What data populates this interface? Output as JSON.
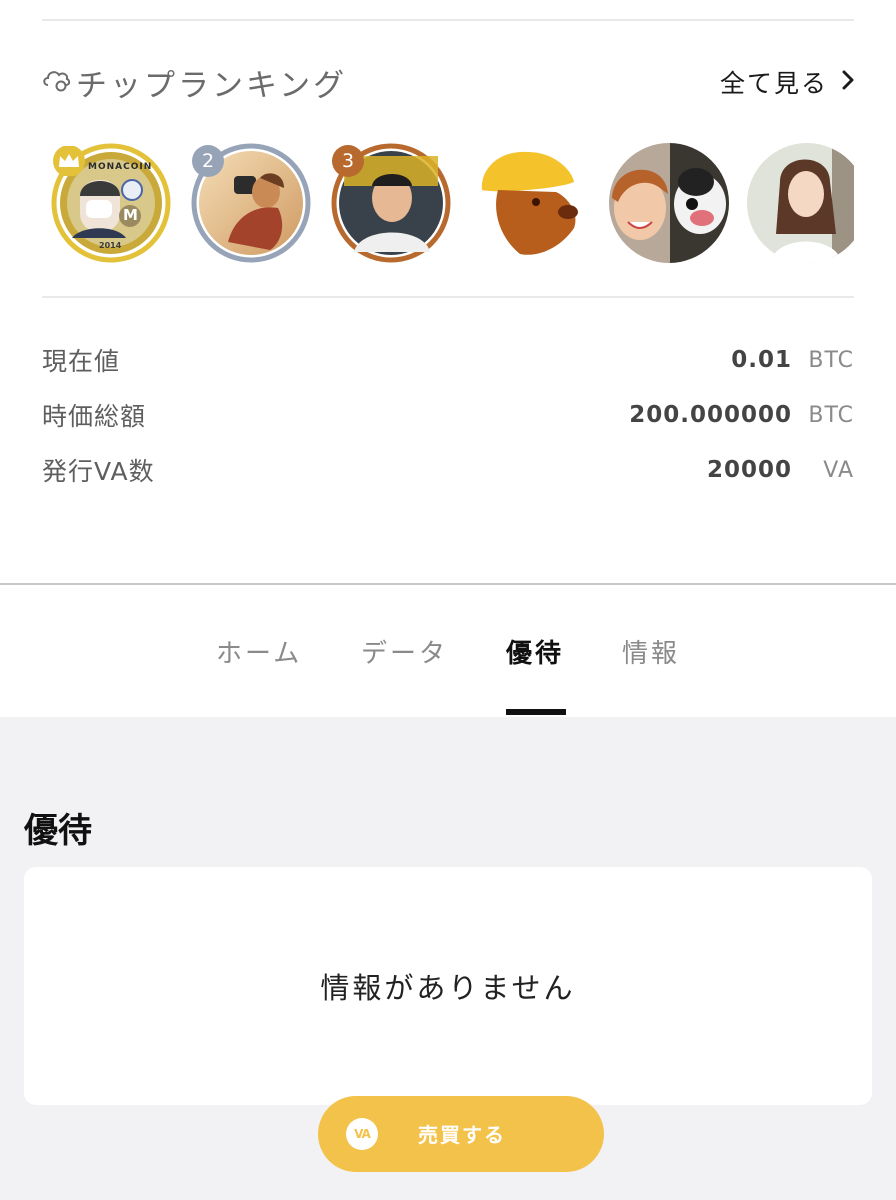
{
  "ranking": {
    "title": "チップランキング",
    "see_all": "全て見る",
    "icon": "chip-cloud-icon",
    "users": [
      {
        "rank": "",
        "crown": true,
        "ring": "#e3c23a"
      },
      {
        "rank": "2",
        "ring": "#97a4b8"
      },
      {
        "rank": "3",
        "ring": "#b8692e"
      },
      {
        "rank": ""
      },
      {
        "rank": ""
      },
      {
        "rank": ""
      }
    ],
    "coin_text": "MONACOIN",
    "coin_year": "2014",
    "coin_mark": "M"
  },
  "stats": [
    {
      "label": "現在値",
      "value": "0.01",
      "unit": "BTC"
    },
    {
      "label": "時価総額",
      "value": "200.000000",
      "unit": "BTC"
    },
    {
      "label": "発行VA数",
      "value": "20000",
      "unit": "VA"
    }
  ],
  "tabs": {
    "home": "ホーム",
    "data": "データ",
    "benefits": "優待",
    "info": "情報",
    "active": "benefits"
  },
  "benefits": {
    "title": "優待",
    "empty": "情報がありません"
  },
  "trade_button": {
    "icon_text": "VA",
    "label": "売買する"
  },
  "colors": {
    "gold": "#e3c23a",
    "silver": "#97a4b8",
    "bronze": "#b8692e",
    "accent": "#f3c24a"
  }
}
